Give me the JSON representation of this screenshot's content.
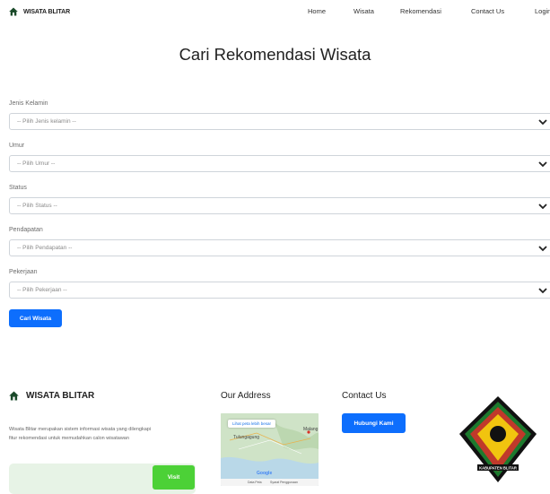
{
  "navbar": {
    "brand": "WISATA BLITAR",
    "links": [
      {
        "label": "Home"
      },
      {
        "label": "Wisata"
      },
      {
        "label": "Rekomendasi"
      },
      {
        "label": "Contact Us"
      },
      {
        "label": "Login"
      }
    ]
  },
  "page": {
    "title": "Cari Rekomendasi Wisata"
  },
  "form": {
    "fields": [
      {
        "label": "Jenis Kelamin",
        "placeholder": "-- Pilih Jenis kelamin --"
      },
      {
        "label": "Umur",
        "placeholder": "-- Pilih Umur --"
      },
      {
        "label": "Status",
        "placeholder": "-- Pilih Status --"
      },
      {
        "label": "Pendapatan",
        "placeholder": "-- Pilih Pendapatan --"
      },
      {
        "label": "Pekerjaan",
        "placeholder": "-- Pilih Pekerjaan --"
      }
    ],
    "submit_label": "Cari Wisata"
  },
  "footer": {
    "brand": "WISATA BLITAR",
    "description_lines": [
      "Wisata Blitar merupakan sistem informasi wisata yang dilengkapi",
      "fitur rekomendasi untuk memudahkan calon wisatawan"
    ],
    "visit_label": "Visit",
    "address_heading": "Our Address",
    "map": {
      "enlarge_label": "Lihat peta lebih besar",
      "places": [
        "Tulungagung",
        "Malang"
      ],
      "google_label": "Google",
      "bottom": [
        "Data Peta",
        "Syarat Penggunaan"
      ]
    },
    "contact_heading": "Contact Us",
    "contact_button": "Hubungi Kami",
    "emblem_caption": "KABUPATEN BLITAR"
  },
  "colors": {
    "primary": "#0d6efd",
    "visit_green": "#4cd137",
    "visit_box_bg": "#e7f3e6"
  }
}
